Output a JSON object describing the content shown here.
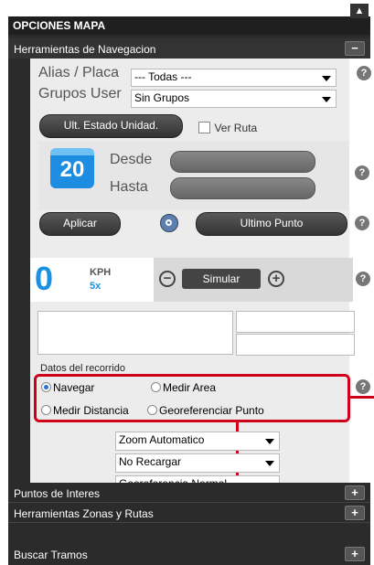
{
  "panel": {
    "title": "OPCIONES MAPA",
    "nav_section": "Herramientas de Navegacion",
    "alias_label": "Alias / Placa",
    "alias_value": "--- Todas ---",
    "grupos_label": "Grupos User",
    "grupos_value": "Sin Grupos",
    "ult_estado_button": "Ult. Estado Unidad.",
    "ver_ruta_label": "Ver Ruta",
    "calendar_day": "20",
    "desde_label": "Desde",
    "hasta_label": "Hasta",
    "aplicar_button": "Aplicar",
    "ultimo_punto_button": "Ultimo Punto",
    "speed_value": "0",
    "speed_unit": "KPH",
    "speed_multiplier": "5x",
    "simular_button": "Simular",
    "datos_label": "Datos del recorrido",
    "radio_navegar": "Navegar",
    "radio_medir_area": "Medir Area",
    "radio_medir_distancia": "Medir Distancia",
    "radio_georeferenciar": "Georeferenciar Punto",
    "select_zoom": "Zoom Automatico",
    "select_recargar": "No Recargar",
    "select_georef": "Georeferencia Normal",
    "sections": {
      "puntos": "Puntos de Interes",
      "zonas": "Herramientas Zonas y Rutas",
      "tramos": "Buscar Tramos"
    }
  },
  "colors": {
    "highlight": "#d0021b",
    "accent": "#1a8fe3"
  }
}
